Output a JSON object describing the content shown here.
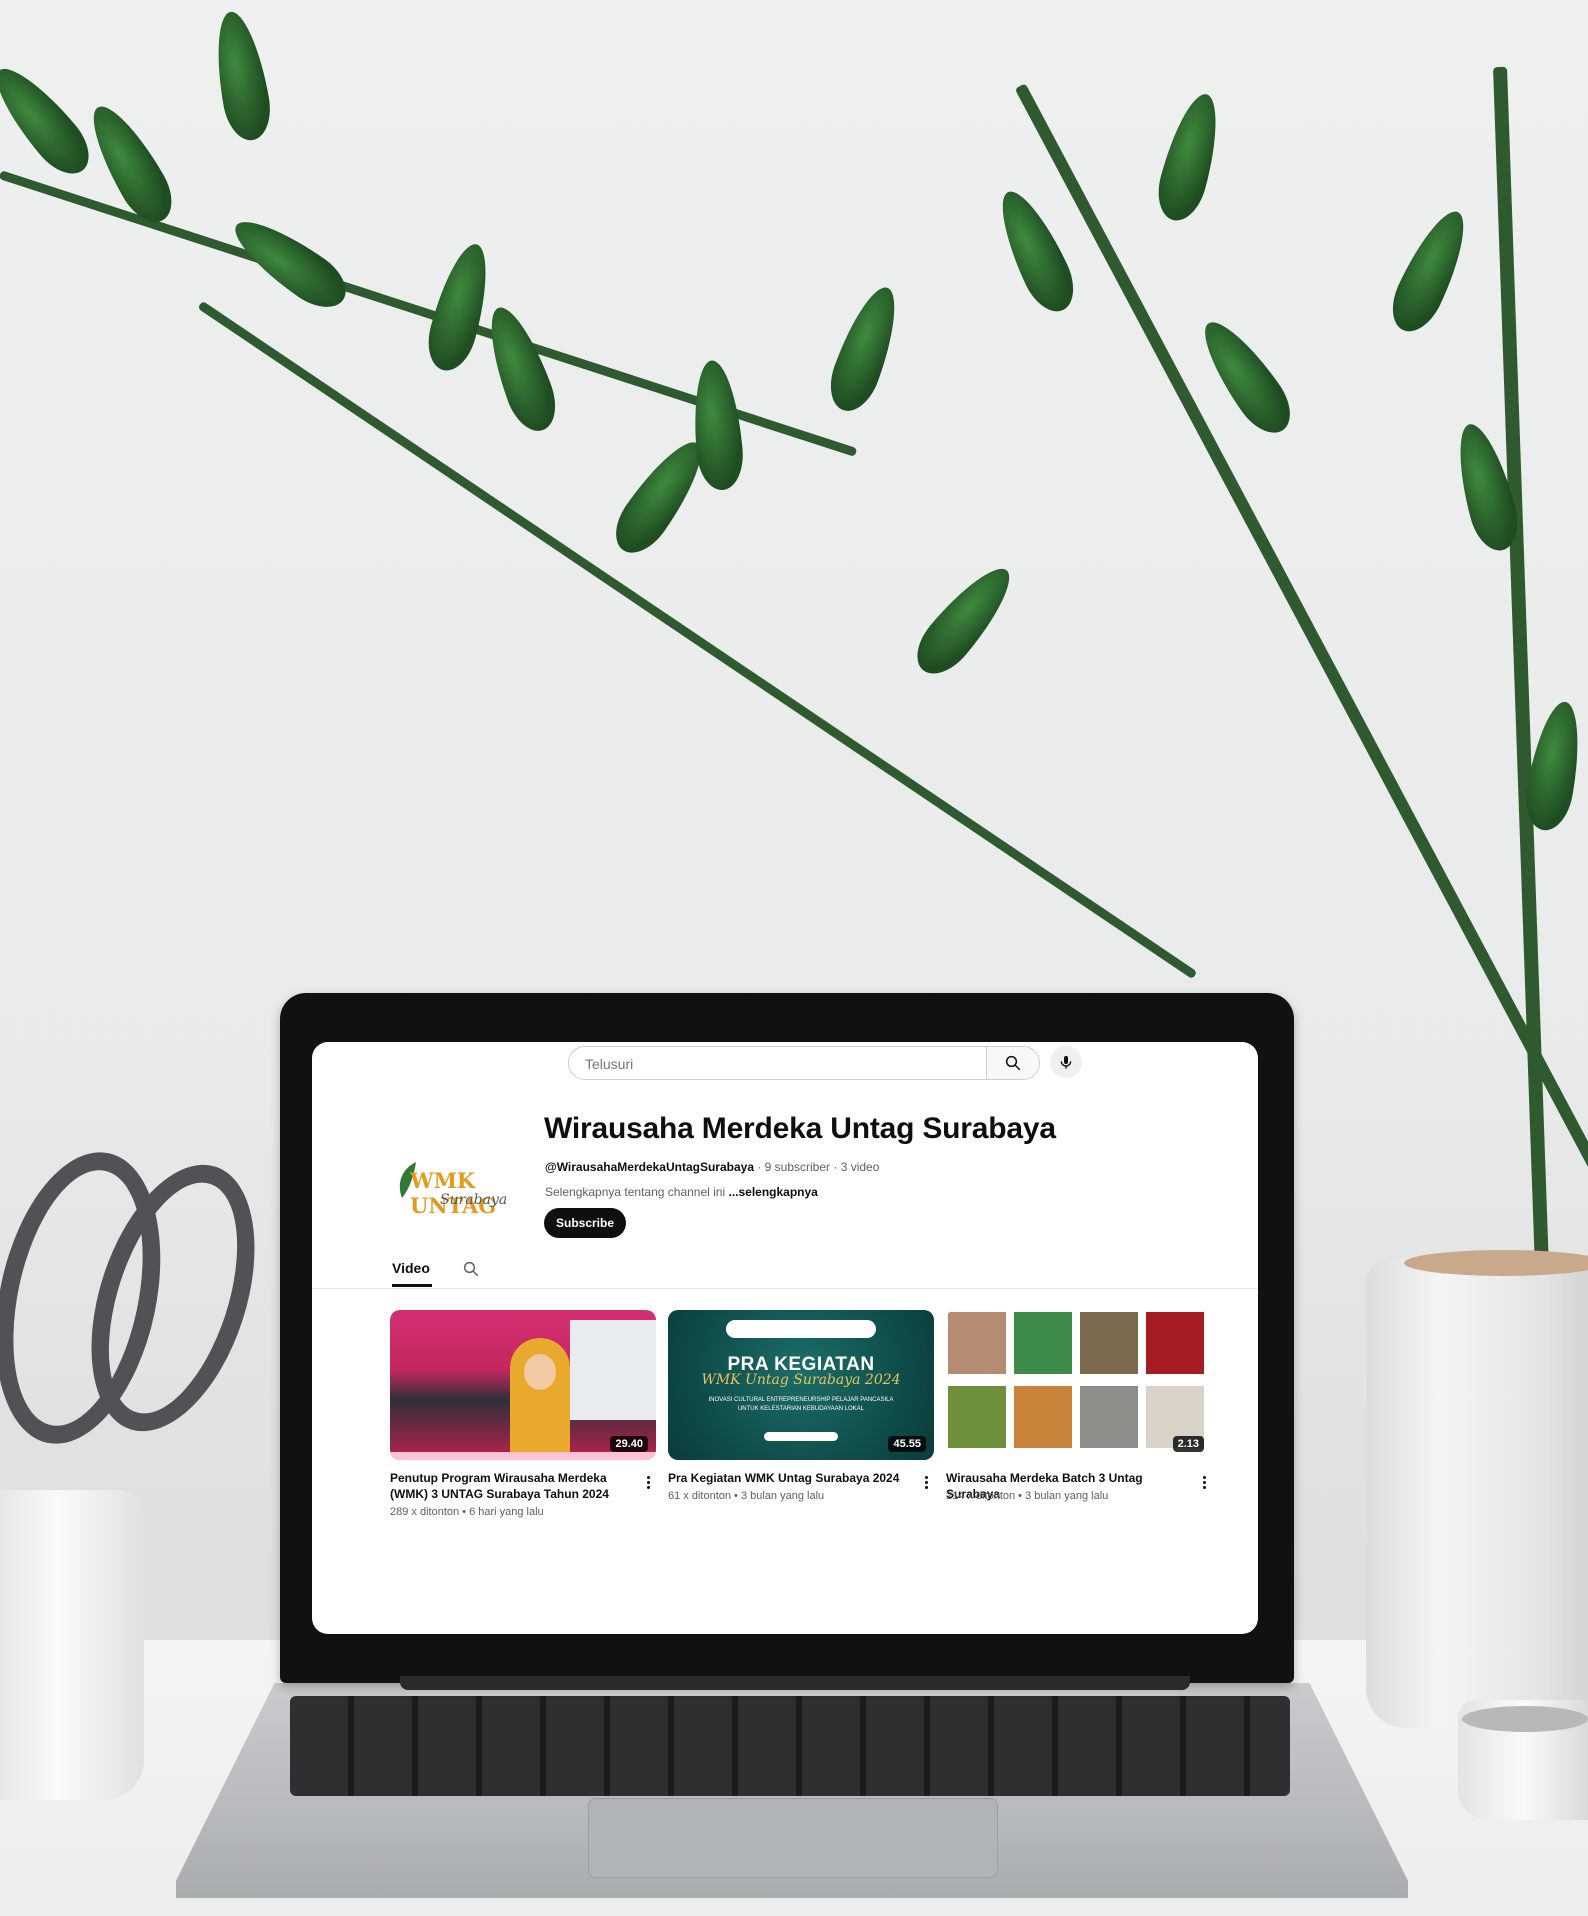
{
  "search": {
    "placeholder": "Telusuri"
  },
  "channel": {
    "avatar_text": "WMK UNTAG",
    "avatar_script": "Surabaya",
    "name": "Wirausaha Merdeka Untag Surabaya",
    "handle": "@WirausahaMerdekaUntagSurabaya",
    "stats": " · 9 subscriber · 3 video",
    "description": "Selengkapnya tentang channel ini ",
    "more": "...selengkapnya",
    "subscribe_label": "Subscribe"
  },
  "tabs": {
    "video": "Video"
  },
  "videos": [
    {
      "title": "Penutup Program Wirausaha Merdeka (WMK) 3 UNTAG Surabaya Tahun 2024",
      "meta": "289 x ditonton • 6 hari yang lalu",
      "duration": "29.40"
    },
    {
      "title": "Pra Kegiatan WMK Untag Surabaya 2024",
      "meta": "61 x ditonton • 3 bulan yang lalu",
      "duration": "45.55",
      "thumb_headline": "PRA KEGIATAN",
      "thumb_script": "WMK Untag Surabaya 2024",
      "thumb_small": "INOVASI CULTURAL ENTREPRENEURSHIP PELAJAR PANCASILA UNTUK KELESTARIAN KEBUDAYAAN LOKAL"
    },
    {
      "title": "Wirausaha Merdeka Batch 3 Untag Surabaya",
      "meta": "214 x ditonton • 3 bulan yang lalu",
      "duration": "2.13"
    }
  ],
  "colors": {
    "accent": "#0f0f0f",
    "secondary_text": "#606060",
    "avatar_orange": "#e39b1f"
  },
  "icons": {
    "search": "search-icon",
    "mic": "mic-icon",
    "tab_search": "search-icon",
    "kebab": "more-vert-icon"
  }
}
